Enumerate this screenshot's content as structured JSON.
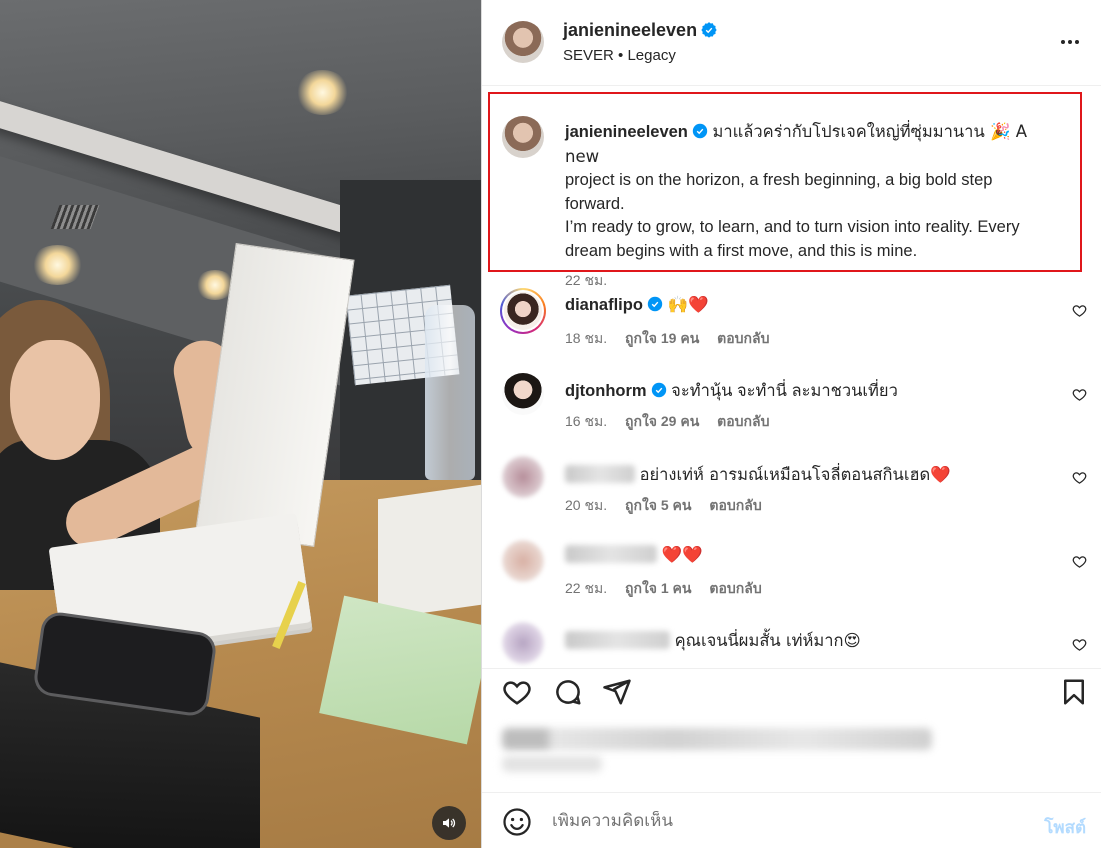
{
  "post": {
    "author": "janienineeleven",
    "music_artist": "SEVER",
    "music_separator": "•",
    "music_title": "Legacy",
    "caption_line1": "มาแล้วคร่ากับโปรเจคใหญ่ที่ซุ่มมานาน 🎉 A new",
    "caption_line2": "project is on the horizon, a fresh beginning, a big bold step",
    "caption_line3": "forward.",
    "caption_line4": "I’m ready to grow, to learn, and to turn vision into reality. Every",
    "caption_line5": "dream begins with a first move, and this is mine.",
    "caption_time": "22 ชม."
  },
  "comments": [
    {
      "user": "dianaflipo",
      "verified": true,
      "text": "🙌❤️",
      "time": "18 ชม.",
      "likes": "ถูกใจ 19 คน",
      "reply": "ตอบกลับ"
    },
    {
      "user": "djtonhorm",
      "verified": true,
      "text": "จะทำนุ้น จะทำนี่ ละมาชวนเที่ยว",
      "time": "16 ชม.",
      "likes": "ถูกใจ 29 คน",
      "reply": "ตอบกลับ"
    },
    {
      "user": "",
      "verified": false,
      "text": "อย่างเท่ห์ อารมณ์เหมือนโจลี่ตอนสกินเฮด❤️",
      "time": "20 ชม.",
      "likes": "ถูกใจ 5 คน",
      "reply": "ตอบกลับ"
    },
    {
      "user": "",
      "verified": false,
      "text": "❤️❤️",
      "time": "22 ชม.",
      "likes": "ถูกใจ 1 คน",
      "reply": "ตอบกลับ"
    },
    {
      "user": "",
      "verified": false,
      "text": "คุณเจนนี่ผมสั้น เท่ห์มาก😍"
    }
  ],
  "composer": {
    "placeholder": "เพิ่มความคิดเห็น",
    "post_label": "โพสต์"
  },
  "icons": {
    "verified": "verified-badge-icon",
    "more": "more-options-icon",
    "like": "heart-icon",
    "comment": "comment-icon",
    "share": "share-icon",
    "save": "bookmark-icon",
    "emoji": "emoji-icon",
    "volume": "volume-icon"
  },
  "colors": {
    "verified": "#0095f6",
    "highlight_border": "#e0171b",
    "post_button": "#b3dbff",
    "secondary_text": "#737373"
  }
}
